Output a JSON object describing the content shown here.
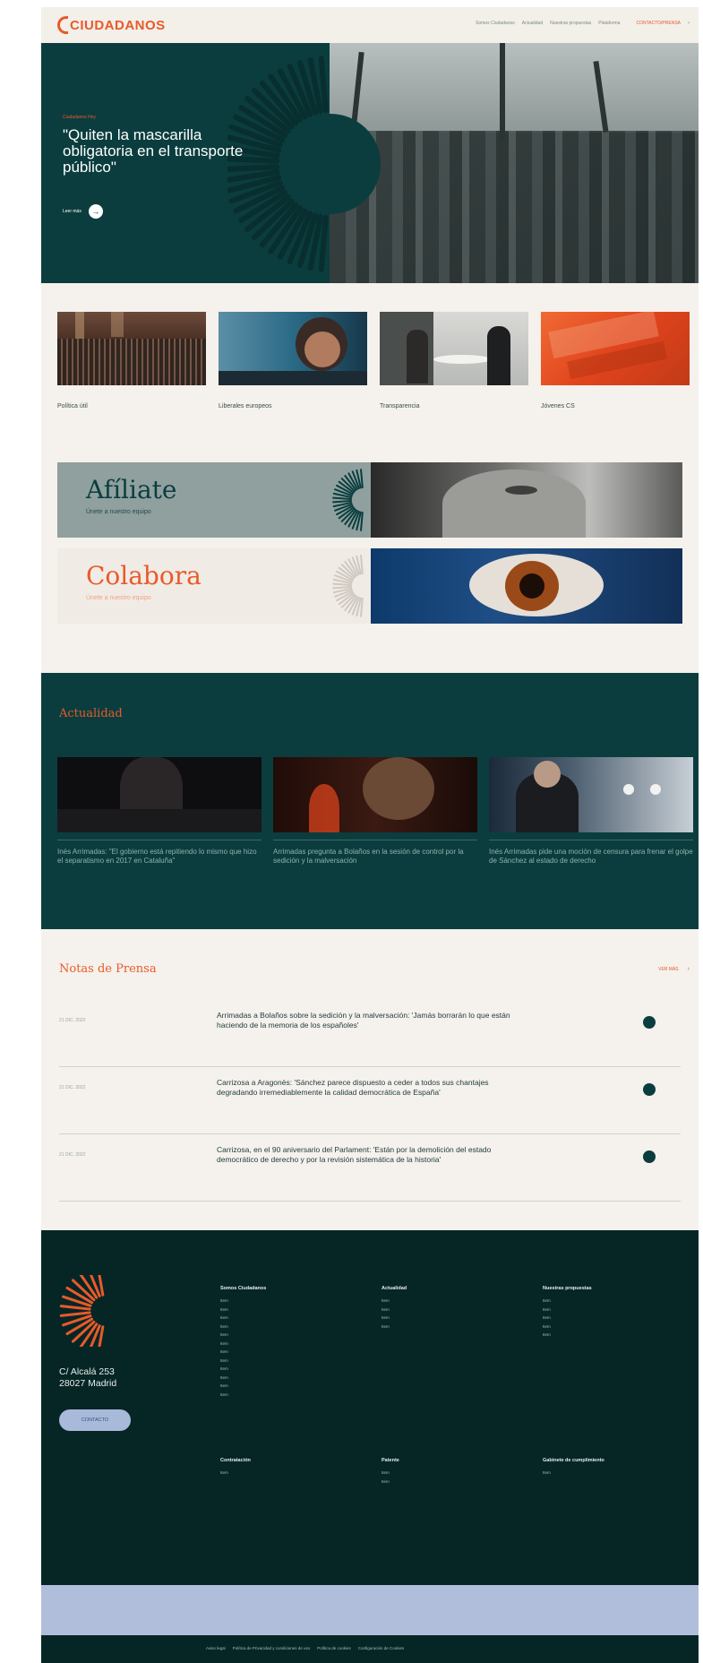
{
  "header": {
    "logo_text": "CIUDADANOS",
    "nav": [
      "Somos Ciudadanos",
      "Actualidad",
      "Nuestras propuestas",
      "Plataforma"
    ],
    "cta": "CONTACTO/PRENSA"
  },
  "hero": {
    "kicker": "Ciudadanos Hoy",
    "title": "\"Quiten la mascarilla obligatoria en el transporte público\"",
    "more_label": "Leer más",
    "more_icon": "→"
  },
  "categories": [
    {
      "label": "Política útil"
    },
    {
      "label": "Liberales europeos"
    },
    {
      "label": "Transparencia"
    },
    {
      "label": "Jóvenes CS"
    }
  ],
  "afiliate": {
    "title": "Afíliate",
    "subtitle": "Únete a nuestro equipo"
  },
  "colabora": {
    "title": "Colabora",
    "subtitle": "Únete a nuestro equipo"
  },
  "actualidad": {
    "title": "Actualidad",
    "items": [
      {
        "text": "Inés Arrimadas: \"El gobierno está repitiendo lo mismo que hizo el separatismo en 2017 en Cataluña\""
      },
      {
        "text": "Arrimadas pregunta a Bolaños en la sesión de control por la sedición y la malversación"
      },
      {
        "text": "Inés Arrimadas pide una moción de censura para frenar el golpe de Sánchez al estado de derecho"
      }
    ]
  },
  "notas": {
    "title": "Notas de Prensa",
    "more_label": "VER MÁS",
    "more_arrow": "›",
    "items": [
      {
        "date": "21 DIC. 2022",
        "text": "Arrimadas a Bolaños sobre la sedición y la malversación: 'Jamás borrarán lo que están haciendo de la memoria de los españoles'"
      },
      {
        "date": "21 DIC. 2022",
        "text": "Carrizosa a Aragonès: 'Sánchez parece dispuesto a ceder a todos sus chantajes degradando irremediablemente la calidad democrática de España'"
      },
      {
        "date": "21 DIC. 2022",
        "text": "Carrizosa, en el 90 aniversario del Parlament: 'Están por la demolición del estado democrático de derecho y por la revisión sistemática de la historia'"
      }
    ]
  },
  "footer": {
    "address_line1": "C/ Alcalá 253",
    "address_line2": "28027 Madrid",
    "contact_label": "CONTACTO",
    "columns": [
      {
        "heading": "Somos Ciudadanos",
        "items": [
          "Item",
          "Item",
          "Item",
          "Item",
          "Item",
          "Item",
          "Item",
          "Item",
          "Item",
          "Item",
          "Item",
          "Item"
        ]
      },
      {
        "heading": "Actualidad",
        "items": [
          "Item",
          "Item",
          "Item",
          "Item"
        ]
      },
      {
        "heading": "Nuestras propuestas",
        "items": [
          "Item",
          "Item",
          "Item",
          "Item",
          "Item"
        ]
      },
      {
        "heading": "Contratación",
        "items": [
          "Item"
        ]
      },
      {
        "heading": "Patente",
        "items": [
          "Item",
          "Item"
        ]
      },
      {
        "heading": "Gabinete de cumplimiento",
        "items": [
          "Item"
        ]
      }
    ],
    "legal": [
      "Aviso legal",
      "Política de Privacidad y condiciones de uso",
      "Política de cookies",
      "Configuración de Cookies"
    ]
  },
  "colors": {
    "brand_orange": "#e85a2a",
    "dark_teal": "#0b3d3e",
    "footer_dark": "#062626",
    "cream": "#f5f1ec",
    "periwinkle": "#b0bedc"
  },
  "icons": {
    "logo": "ciudadanos-c-icon",
    "hero_more": "arrow-right-icon",
    "nota_button": "dot-button-icon",
    "chevron": "chevron-right-icon",
    "burst": "sunburst-icon"
  }
}
